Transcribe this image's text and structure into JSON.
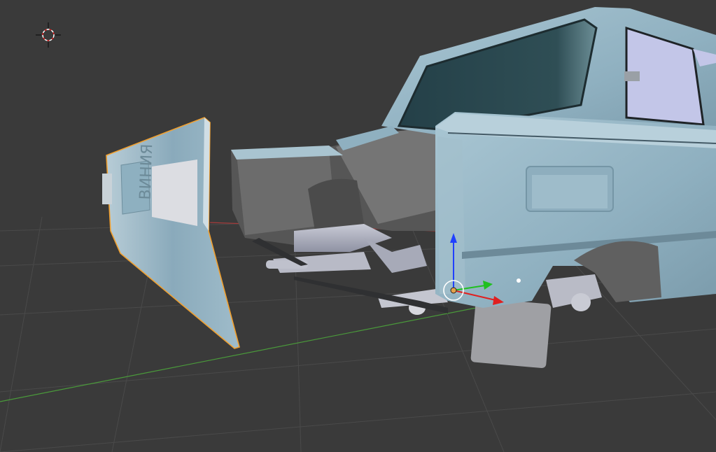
{
  "viewport": {
    "background": "#3a3a3a",
    "grid_color": "#4b4b4b",
    "x_axis_color": "#b23a3a",
    "y_axis_color": "#4f9a3a"
  },
  "scene": {
    "selected_object_outline": "#f0a030",
    "body_color": "#93b4c4",
    "glass_color": "#2d4a50",
    "license_plate_text": "ВИНИЯ"
  },
  "cursor_3d": {
    "icon": "3d-cursor-icon"
  },
  "gizmo": {
    "icon": "translate-gizmo-icon",
    "x_color": "#e02020",
    "y_color": "#20c020",
    "z_color": "#2040ff"
  }
}
